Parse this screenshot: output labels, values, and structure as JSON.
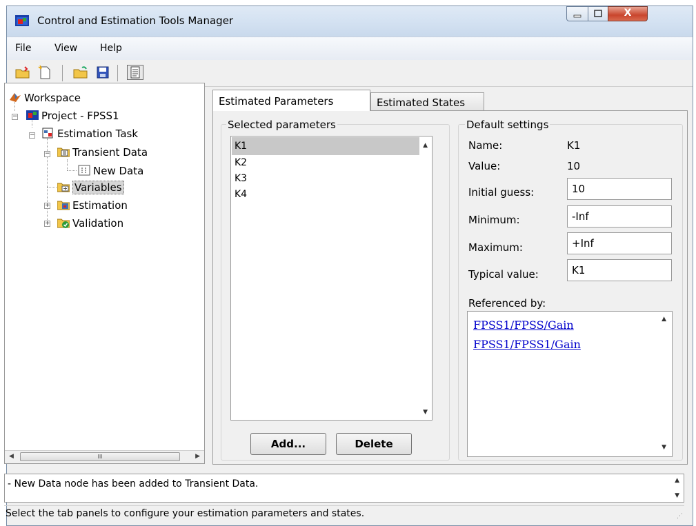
{
  "window": {
    "title": "Control and Estimation Tools Manager",
    "minimize_glyph": "—",
    "maximize_glyph": "▢",
    "close_glyph": "X"
  },
  "menu": [
    "File",
    "View",
    "Help"
  ],
  "toolbar": [
    "open-project-icon",
    "new-icon",
    "open-folder-icon",
    "save-icon",
    "properties-icon"
  ],
  "tree": {
    "nodes": [
      {
        "label": "Workspace",
        "icon": "matlab-icon"
      },
      {
        "label": "Project - FPSS1",
        "icon": "project-icon"
      },
      {
        "label": "Estimation Task",
        "icon": "estimation-task-icon"
      },
      {
        "label": "Transient Data",
        "icon": "data-folder-icon"
      },
      {
        "label": "New Data",
        "icon": "data-table-icon"
      },
      {
        "label": "Variables",
        "icon": "variables-folder-icon"
      },
      {
        "label": "Estimation",
        "icon": "estimation-folder-icon"
      },
      {
        "label": "Validation",
        "icon": "validation-folder-icon"
      }
    ],
    "hscroll_grip": "III"
  },
  "tabs": [
    {
      "label": "Estimated Parameters",
      "active": true
    },
    {
      "label": "Estimated States",
      "active": false
    }
  ],
  "selected_parameters": {
    "label": "Selected parameters",
    "items": [
      "K1",
      "K2",
      "K3",
      "K4"
    ],
    "selected_index": 0,
    "add_label": "Add...",
    "delete_label": "Delete"
  },
  "default_settings": {
    "label": "Default settings",
    "name_label": "Name:",
    "name_value": "K1",
    "value_label": "Value:",
    "value_value": "10",
    "initial_guess_label": "Initial guess:",
    "initial_guess_value": "10",
    "minimum_label": "Minimum:",
    "minimum_value": "-Inf",
    "maximum_label": "Maximum:",
    "maximum_value": "+Inf",
    "typical_value_label": "Typical value:",
    "typical_value_value": "K1",
    "referenced_by_label": "Referenced by:",
    "referenced_by": [
      "FPSS1/FPSS/Gain",
      "FPSS1/FPSS1/Gain"
    ]
  },
  "status": {
    "message": "- New Data node has been added to Transient Data.",
    "hint": "Select the tab panels to configure your estimation parameters and states."
  }
}
